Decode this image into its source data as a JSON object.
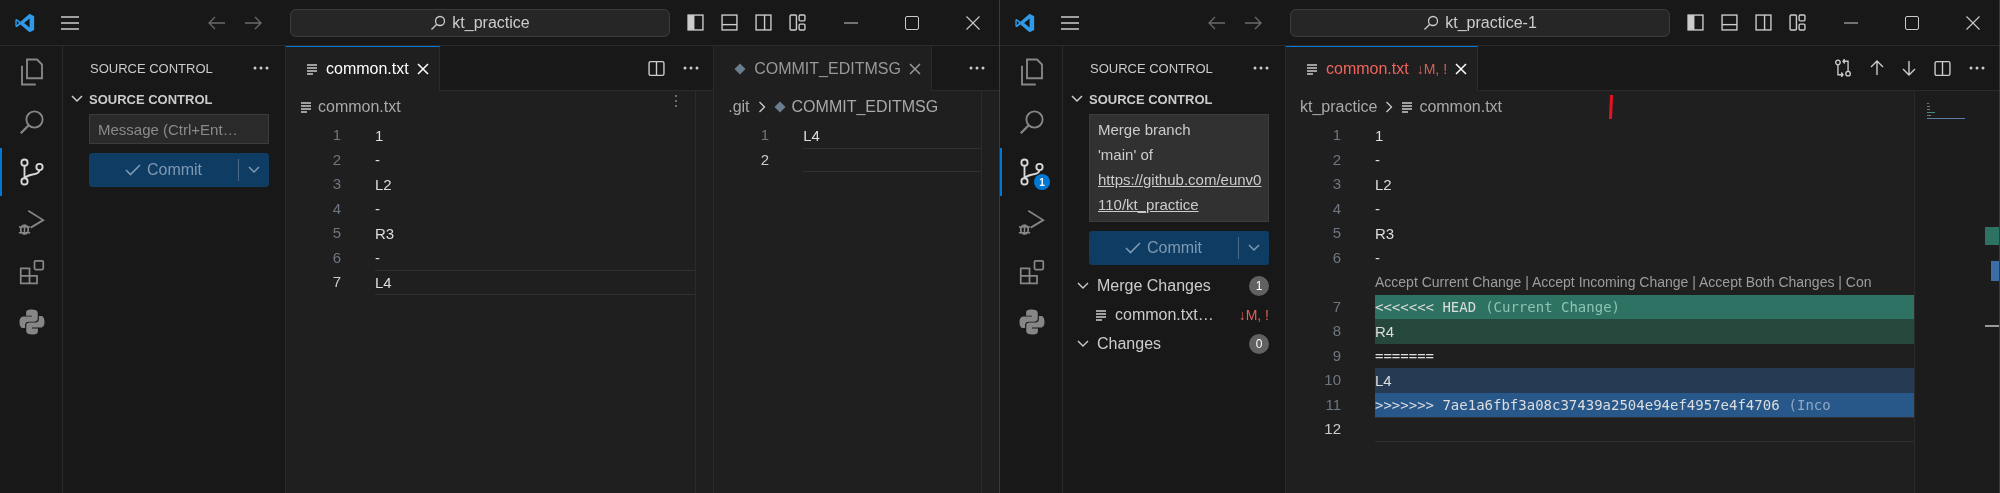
{
  "windows": [
    {
      "title_bar": {
        "search": "kt_practice"
      },
      "activity_bar": [
        {
          "kind": "explorer",
          "selected": false
        },
        {
          "kind": "search",
          "selected": false
        },
        {
          "kind": "source_control",
          "selected": true
        },
        {
          "kind": "run_debug",
          "selected": false
        },
        {
          "kind": "extensions",
          "selected": false
        },
        {
          "kind": "python",
          "selected": false
        }
      ],
      "sidebar": {
        "title": "SOURCE CONTROL",
        "section": "SOURCE CONTROL",
        "message": {
          "placeholder": "Message (Ctrl+Ent…"
        },
        "commit_button": "Commit"
      },
      "editor_groups": [
        {
          "focused": true,
          "tabs": [
            {
              "label": "common.txt",
              "kind": "text_file",
              "selected": true
            }
          ],
          "toolbar": [
            {
              "kind": "split"
            },
            {
              "kind": "more"
            }
          ],
          "breadcrumb": [
            {
              "label": "common.txt",
              "kind": "text_file"
            }
          ],
          "sticky_dots": true,
          "lines": [
            {
              "number": "1",
              "text": "1",
              "kind": "plain",
              "current": false
            },
            {
              "number": "2",
              "text": "-",
              "kind": "plain",
              "current": false
            },
            {
              "number": "3",
              "text": "L2",
              "kind": "plain",
              "current": false
            },
            {
              "number": "4",
              "text": "-",
              "kind": "plain",
              "current": false
            },
            {
              "number": "5",
              "text": "R3",
              "kind": "plain",
              "current": false
            },
            {
              "number": "6",
              "text": "-",
              "kind": "plain",
              "current": false
            },
            {
              "number": "7",
              "text": "L4",
              "kind": "plain",
              "current": true
            }
          ]
        },
        {
          "focused": false,
          "tabs": [
            {
              "label": "COMMIT_EDITMSG",
              "kind": "git_file",
              "selected": true
            }
          ],
          "toolbar": [
            {
              "kind": "more"
            }
          ],
          "breadcrumb": [
            {
              "label": ".git",
              "kind": "folder"
            },
            {
              "label": "COMMIT_EDITMSG",
              "kind": "git_file"
            }
          ],
          "lines": [
            {
              "number": "1",
              "text": "L4",
              "kind": "plain",
              "current": false
            },
            {
              "number": "2",
              "kind": "plain",
              "current": true
            }
          ]
        }
      ]
    },
    {
      "title_bar": {
        "search": "kt_practice-1"
      },
      "activity_bar": [
        {
          "kind": "explorer",
          "selected": false
        },
        {
          "kind": "search",
          "selected": false
        },
        {
          "kind": "source_control",
          "selected": true,
          "badge": "1"
        },
        {
          "kind": "run_debug",
          "selected": false
        },
        {
          "kind": "extensions",
          "selected": false
        },
        {
          "kind": "python",
          "selected": false
        }
      ],
      "sidebar": {
        "title": "SOURCE CONTROL",
        "section": "SOURCE CONTROL",
        "message": {
          "text": "Merge branch 'main' of",
          "link": "https://github.com/eunv0110/kt_practice"
        },
        "commit_button": "Commit",
        "groups": [
          {
            "label": "Merge Changes",
            "count": "1",
            "expanded": true,
            "items": [
              {
                "label": "common.txt…",
                "status": "↓M, !",
                "kind": "text_file"
              }
            ]
          },
          {
            "label": "Changes",
            "count": "0",
            "expanded": true
          }
        ]
      },
      "editor_groups": [
        {
          "focused": true,
          "tabs": [
            {
              "label": "common.txt",
              "status": "↓M, !",
              "conflict": true,
              "kind": "text_file",
              "selected": true
            }
          ],
          "toolbar": [
            {
              "kind": "compare"
            },
            {
              "kind": "up"
            },
            {
              "kind": "down"
            },
            {
              "kind": "split"
            },
            {
              "kind": "more"
            }
          ],
          "breadcrumb": [
            {
              "label": "kt_practice",
              "kind": "folder"
            },
            {
              "label": "common.txt",
              "kind": "text_file"
            }
          ],
          "pen_mark": true,
          "minimap": true,
          "lines": [
            {
              "number": "1",
              "text": "1",
              "kind": "plain",
              "current": false
            },
            {
              "number": "2",
              "text": "-",
              "kind": "plain",
              "current": false
            },
            {
              "number": "3",
              "text": "L2",
              "kind": "plain",
              "current": false
            },
            {
              "number": "4",
              "text": "-",
              "kind": "plain",
              "current": false
            },
            {
              "number": "5",
              "text": "R3",
              "kind": "plain",
              "current": false
            },
            {
              "number": "6",
              "text": "-",
              "kind": "plain",
              "current": false
            },
            {
              "text": "Accept Current Change | Accept Incoming Change | Accept Both Changes | Con",
              "kind": "codelens"
            },
            {
              "number": "7",
              "text": "<<<<<<< HEAD",
              "annotation": "(Current Change)",
              "kind": "current_header",
              "current": false
            },
            {
              "number": "8",
              "text": "R4",
              "kind": "current_body",
              "current": false
            },
            {
              "number": "9",
              "text": "=======",
              "kind": "separator",
              "current": false
            },
            {
              "number": "10",
              "text": "L4",
              "kind": "incoming_body",
              "current": false
            },
            {
              "number": "11",
              "text": ">>>>>>> 7ae1a6fbf3a08c37439a2504e94ef4957e4f4706",
              "annotation": "(Inco",
              "kind": "incoming_header",
              "current": false
            },
            {
              "number": "12",
              "kind": "plain",
              "current": true
            }
          ]
        }
      ]
    }
  ]
}
